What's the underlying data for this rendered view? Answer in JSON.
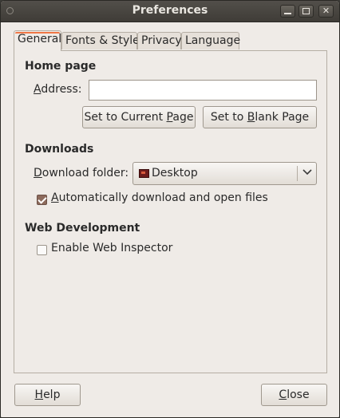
{
  "window": {
    "title": "Preferences"
  },
  "titlebar": {
    "minimize_glyph": "",
    "maximize_glyph": "",
    "close_glyph": "✕"
  },
  "tabs": [
    {
      "label": "General",
      "active": true
    },
    {
      "label": "Fonts & Style",
      "active": false
    },
    {
      "label": "Privacy",
      "active": false
    },
    {
      "label": "Language",
      "active": false
    }
  ],
  "home_page": {
    "section_title": "Home page",
    "address_label_mn": "A",
    "address_label_rest": "ddress:",
    "address_value": "",
    "set_current_pre": "Set to Current ",
    "set_current_mn": "P",
    "set_current_post": "age",
    "set_blank_pre": "Set to ",
    "set_blank_mn": "B",
    "set_blank_post": "lank Page"
  },
  "downloads": {
    "section_title": "Downloads",
    "folder_label_mn": "D",
    "folder_label_rest": "ownload folder:",
    "folder_value": "Desktop",
    "folder_icon": "folder-icon",
    "auto_open_mn": "A",
    "auto_open_rest": "utomatically download and open files",
    "auto_open_checked": true
  },
  "web_development": {
    "section_title": "Web Development",
    "inspector_label": "Enable Web Inspector",
    "inspector_checked": false
  },
  "footer": {
    "help_mn": "H",
    "help_rest": "elp",
    "close_mn": "C",
    "close_rest": "lose"
  },
  "colors": {
    "titlebar": "#3f3c37",
    "window_bg": "#efebe7",
    "tab_accent": "#f07746",
    "checkbox_on": "#8c6a5c"
  }
}
